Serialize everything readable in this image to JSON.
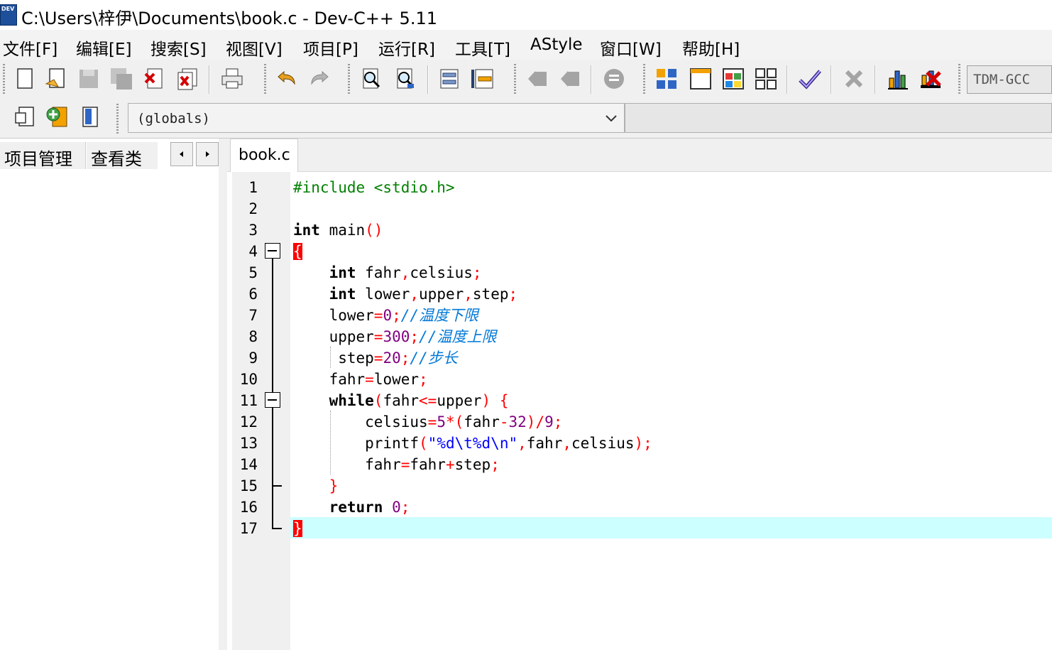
{
  "window": {
    "title": "C:\\Users\\梓伊\\Documents\\book.c - Dev-C++ 5.11",
    "icon": "devcpp-app-icon",
    "icon_label": "DEV"
  },
  "menu": [
    "文件[F]",
    "编辑[E]",
    "搜索[S]",
    "视图[V]",
    "项目[P]",
    "运行[R]",
    "工具[T]",
    "AStyle",
    "窗口[W]",
    "帮助[H]"
  ],
  "toolbar": {
    "icons": [
      "new-file-icon",
      "open-file-icon",
      "save-icon",
      "save-all-icon",
      "close-icon",
      "close-all-icon",
      "print-icon",
      "undo-icon",
      "redo-icon",
      "find-icon",
      "replace-icon",
      "indent-icon",
      "unindent-icon",
      "goto-back-icon",
      "goto-forward-icon",
      "bookmark-icon",
      "layout-grid-icon",
      "window-icon",
      "colors-icon",
      "tiles-icon",
      "check-icon",
      "clear-icon",
      "chart-icon",
      "stop-icon"
    ],
    "compiler": "TDM-GCC"
  },
  "toolbar2": {
    "icons": [
      "project-exit-icon",
      "add-file-icon",
      "project-options-icon"
    ],
    "scope_select": "(globals)"
  },
  "left_panel": {
    "tabs": [
      "项目管理",
      "查看类"
    ]
  },
  "editor": {
    "tab_label": "book.c",
    "current_line": 17
  },
  "colors": {
    "keyword": "#000000",
    "preprocessor": "#008000",
    "symbol": "#ff0000",
    "number": "#800080",
    "string": "#0000ff",
    "comment": "#0078d7",
    "current_line_bg": "#ccffff"
  },
  "code": {
    "lines": [
      {
        "n": "1",
        "tokens": [
          [
            "pre",
            "#include <stdio.h>"
          ]
        ]
      },
      {
        "n": "2",
        "tokens": []
      },
      {
        "n": "3",
        "tokens": [
          [
            "kw",
            "int"
          ],
          [
            "txt",
            " main"
          ],
          [
            "sym",
            "()"
          ]
        ]
      },
      {
        "n": "4",
        "tokens": [
          [
            "brace",
            "{"
          ]
        ]
      },
      {
        "n": "5",
        "tokens": [
          [
            "txt",
            "    "
          ],
          [
            "kw",
            "int"
          ],
          [
            "txt",
            " fahr"
          ],
          [
            "sym",
            ","
          ],
          [
            "txt",
            "celsius"
          ],
          [
            "sym",
            ";"
          ]
        ]
      },
      {
        "n": "6",
        "tokens": [
          [
            "txt",
            "    "
          ],
          [
            "kw",
            "int"
          ],
          [
            "txt",
            " lower"
          ],
          [
            "sym",
            ","
          ],
          [
            "txt",
            "upper"
          ],
          [
            "sym",
            ","
          ],
          [
            "txt",
            "step"
          ],
          [
            "sym",
            ";"
          ]
        ]
      },
      {
        "n": "7",
        "tokens": [
          [
            "txt",
            "    lower"
          ],
          [
            "sym",
            "="
          ],
          [
            "num",
            "0"
          ],
          [
            "sym",
            ";"
          ],
          [
            "cmt",
            "//温度下限"
          ]
        ]
      },
      {
        "n": "8",
        "tokens": [
          [
            "txt",
            "    upper"
          ],
          [
            "sym",
            "="
          ],
          [
            "num",
            "300"
          ],
          [
            "sym",
            ";"
          ],
          [
            "cmt",
            "//温度上限"
          ]
        ]
      },
      {
        "n": "9",
        "tokens": [
          [
            "txt",
            "     step"
          ],
          [
            "sym",
            "="
          ],
          [
            "num",
            "20"
          ],
          [
            "sym",
            ";"
          ],
          [
            "cmt",
            "//步长"
          ]
        ]
      },
      {
        "n": "10",
        "tokens": [
          [
            "txt",
            "    fahr"
          ],
          [
            "sym",
            "="
          ],
          [
            "txt",
            "lower"
          ],
          [
            "sym",
            ";"
          ]
        ]
      },
      {
        "n": "11",
        "tokens": [
          [
            "txt",
            "    "
          ],
          [
            "kw",
            "while"
          ],
          [
            "sym",
            "("
          ],
          [
            "txt",
            "fahr"
          ],
          [
            "sym",
            "<="
          ],
          [
            "txt",
            "upper"
          ],
          [
            "sym",
            ")"
          ],
          [
            "txt",
            " "
          ],
          [
            "sym",
            "{"
          ]
        ]
      },
      {
        "n": "12",
        "tokens": [
          [
            "txt",
            "        celsius"
          ],
          [
            "sym",
            "="
          ],
          [
            "num",
            "5"
          ],
          [
            "sym",
            "*("
          ],
          [
            "txt",
            "fahr"
          ],
          [
            "sym",
            "-"
          ],
          [
            "num",
            "32"
          ],
          [
            "sym",
            ")/"
          ],
          [
            "num",
            "9"
          ],
          [
            "sym",
            ";"
          ]
        ]
      },
      {
        "n": "13",
        "tokens": [
          [
            "txt",
            "        printf"
          ],
          [
            "sym",
            "("
          ],
          [
            "str",
            "\"%d\\t%d\\n\""
          ],
          [
            "sym",
            ","
          ],
          [
            "txt",
            "fahr"
          ],
          [
            "sym",
            ","
          ],
          [
            "txt",
            "celsius"
          ],
          [
            "sym",
            ");"
          ]
        ]
      },
      {
        "n": "14",
        "tokens": [
          [
            "txt",
            "        fahr"
          ],
          [
            "sym",
            "="
          ],
          [
            "txt",
            "fahr"
          ],
          [
            "sym",
            "+"
          ],
          [
            "txt",
            "step"
          ],
          [
            "sym",
            ";"
          ]
        ]
      },
      {
        "n": "15",
        "tokens": [
          [
            "txt",
            "    "
          ],
          [
            "sym",
            "}"
          ]
        ]
      },
      {
        "n": "16",
        "tokens": [
          [
            "txt",
            "    "
          ],
          [
            "kw",
            "return"
          ],
          [
            "txt",
            " "
          ],
          [
            "num",
            "0"
          ],
          [
            "sym",
            ";"
          ]
        ]
      },
      {
        "n": "17",
        "tokens": [
          [
            "brace",
            "}"
          ]
        ]
      }
    ]
  }
}
